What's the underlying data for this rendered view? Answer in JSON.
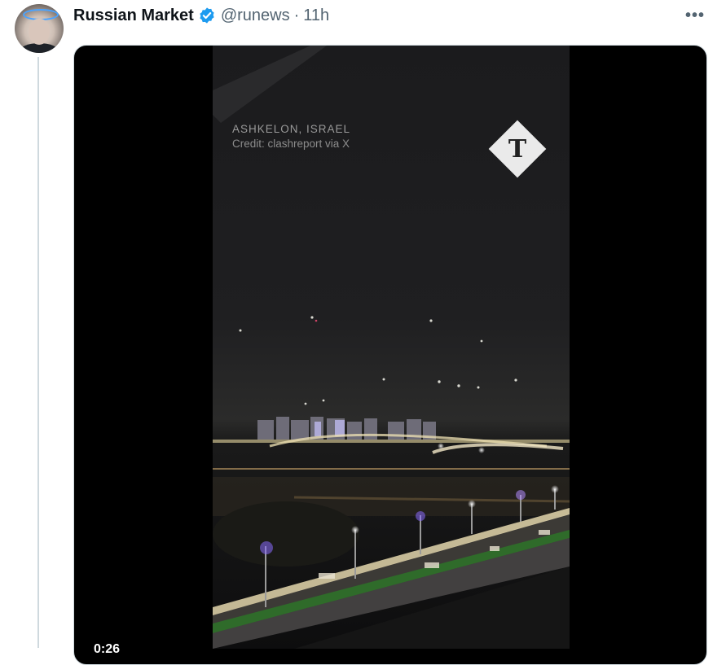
{
  "tweet": {
    "author_name": "Russian Market",
    "handle": "@runews",
    "separator": "·",
    "time": "11h",
    "more_label": "•••"
  },
  "video": {
    "location_text": "ASHKELON, ISRAEL",
    "credit_text": "Credit: clashreport via X",
    "logo_letter": "T",
    "timestamp": "0:26"
  },
  "colors": {
    "verified_badge": "#1d9bf0",
    "secondary_text": "#536471",
    "thread_line": "#cfd9de"
  }
}
